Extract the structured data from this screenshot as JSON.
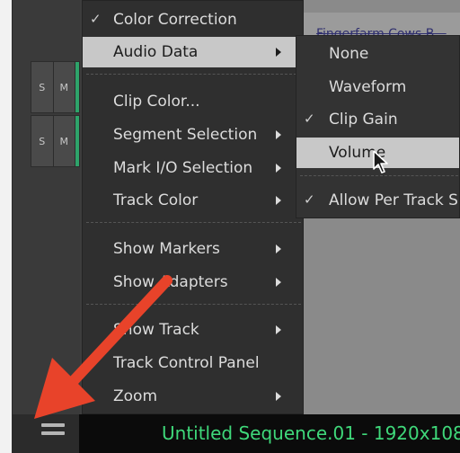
{
  "tracks": [
    {
      "solo": "S",
      "mute": "M"
    },
    {
      "solo": "S",
      "mute": "M"
    }
  ],
  "clip": {
    "name": "Fingerfarm Cows B..."
  },
  "main_menu": {
    "items": [
      {
        "label": "Color Correction",
        "checked": true,
        "submenu": false
      },
      {
        "label": "Audio Data",
        "checked": false,
        "submenu": true,
        "highlighted": true
      },
      {
        "label": "Clip Color...",
        "checked": false,
        "submenu": false
      },
      {
        "label": "Segment Selection",
        "checked": false,
        "submenu": true
      },
      {
        "label": "Mark I/O Selection",
        "checked": false,
        "submenu": true
      },
      {
        "label": "Track Color",
        "checked": false,
        "submenu": true
      },
      {
        "label": "Show Markers",
        "checked": false,
        "submenu": true
      },
      {
        "label": "Show Adapters",
        "checked": false,
        "submenu": true
      },
      {
        "label": "Show Track",
        "checked": false,
        "submenu": true
      },
      {
        "label": "Track Control Panel",
        "checked": false,
        "submenu": false
      },
      {
        "label": "Zoom",
        "checked": false,
        "submenu": true
      }
    ]
  },
  "audio_submenu": {
    "items": [
      {
        "label": "None",
        "checked": false
      },
      {
        "label": "Waveform",
        "checked": false
      },
      {
        "label": "Clip Gain",
        "checked": true
      },
      {
        "label": "Volume",
        "checked": false,
        "highlighted": true
      },
      {
        "label": "Allow Per Track S",
        "checked": true
      }
    ]
  },
  "check_glyph": "✓",
  "sequence": {
    "title": "Untitled Sequence.01 - 1920x108"
  },
  "colors": {
    "accent_green": "#2ea36a",
    "sequence_text": "#3fd87a",
    "annotation_arrow": "#e8432a",
    "menu_highlight": "#c8c8c8"
  }
}
